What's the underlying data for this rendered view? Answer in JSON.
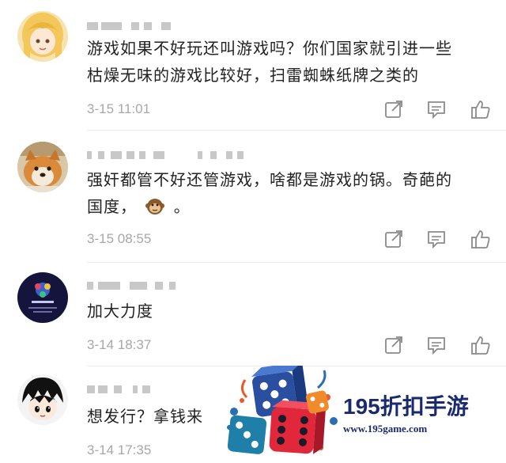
{
  "comments": [
    {
      "content_line1": "游戏如果不好玩还叫游戏吗？你们国家就引进一些",
      "content_line2": "枯燥无味的游戏比较好，扫雷蜘蛛纸牌之类的",
      "timestamp": "3-15 11:01",
      "avatar": "anime-girl-avatar"
    },
    {
      "content_line1": "强奸都管不好还管游戏，啥都是游戏的锅。奇葩的",
      "content_line2_before": "国度，",
      "content_line2_after": "。",
      "emoji": "monkey-emoji",
      "timestamp": "3-15 08:55",
      "avatar": "shiba-dog-avatar"
    },
    {
      "content_line1": "加大力度",
      "timestamp": "3-14 18:37",
      "avatar": "dark-logo-avatar"
    },
    {
      "content_line1": "想发行？拿钱来",
      "timestamp": "3-14 17:35",
      "avatar": "chibi-boy-avatar"
    }
  ],
  "actions": {
    "share_icon": "share-icon",
    "reply_icon": "reply-icon",
    "like_icon": "thumbs-up-icon"
  },
  "watermark": {
    "title": "195折扣手游",
    "url": "www.195game.com"
  },
  "colors": {
    "text": "#222222",
    "meta": "#a8a8a8",
    "divider": "#ececec",
    "brand": "#1a2a6e"
  }
}
